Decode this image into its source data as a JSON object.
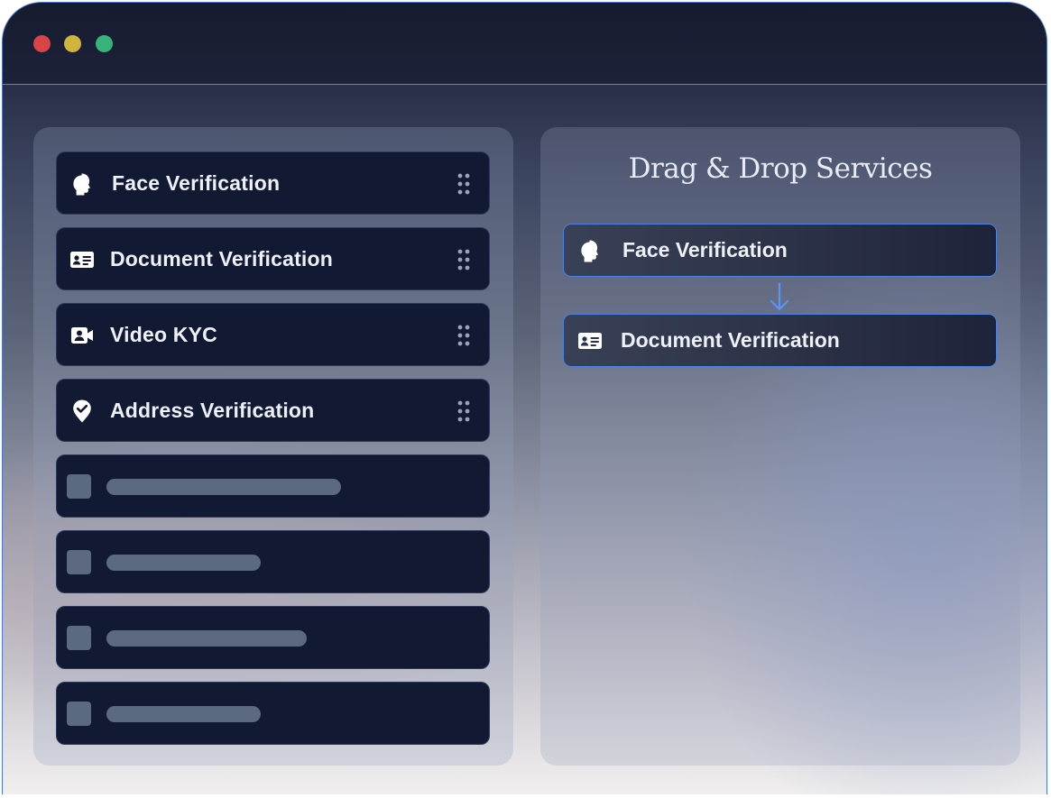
{
  "window": {
    "controls": [
      "close",
      "minimize",
      "maximize"
    ],
    "colors": {
      "close": "#d94447",
      "minimize": "#cfb53c",
      "maximize": "#36b37a",
      "accent": "#4a82e6"
    }
  },
  "services": [
    {
      "label": "Face Verification",
      "icon": "face-silhouette-icon"
    },
    {
      "label": "Document Verification",
      "icon": "id-card-icon"
    },
    {
      "label": "Video KYC",
      "icon": "video-camera-icon"
    },
    {
      "label": "Address Verification",
      "icon": "location-check-icon"
    }
  ],
  "placeholders": [
    {
      "bar_fraction": 0.61
    },
    {
      "bar_fraction": 0.4
    },
    {
      "bar_fraction": 0.52
    },
    {
      "bar_fraction": 0.4
    }
  ],
  "builder": {
    "title": "Drag & Drop Services",
    "selected": [
      {
        "label": "Face Verification",
        "icon": "face-silhouette-icon"
      },
      {
        "label": "Document Verification",
        "icon": "id-card-icon"
      }
    ],
    "connector_icon": "arrow-down-icon"
  }
}
